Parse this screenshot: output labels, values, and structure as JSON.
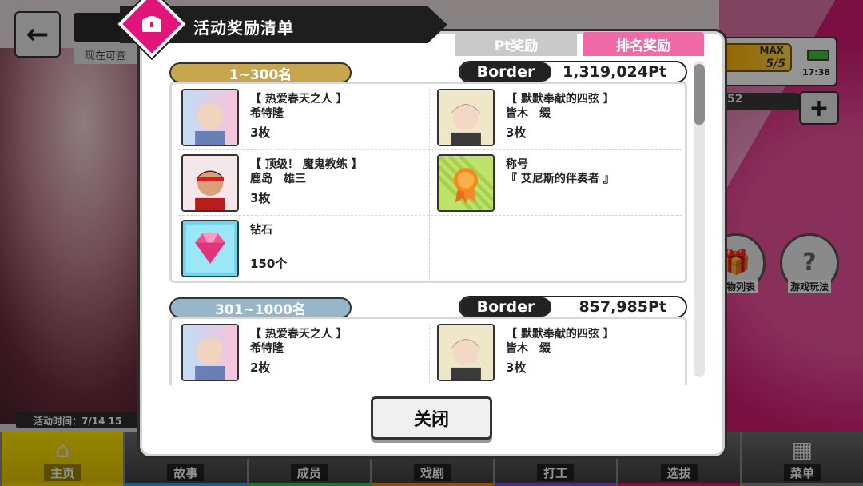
{
  "header": {
    "back_icon": "back-arrow-icon",
    "now_label": "现在可查"
  },
  "hud": {
    "energy_max": "MAX",
    "energy_count": "5/5",
    "clock": "17:38",
    "stat_value": "52",
    "plus_label": "+"
  },
  "side_buttons": [
    {
      "label": "礼物列表",
      "icon": "gift-icon"
    },
    {
      "label": "游戏玩法",
      "icon": "question-icon"
    }
  ],
  "event_time": "活动时间：7/14 15",
  "nav": [
    {
      "label": "主页",
      "icon": "home-icon",
      "color": "#f4d800"
    },
    {
      "label": "故事",
      "icon": "book-icon",
      "color": "#2ea3e6"
    },
    {
      "label": "成员",
      "icon": "people-icon",
      "color": "#2ec45d"
    },
    {
      "label": "戏剧",
      "icon": "drama-icon",
      "color": "#f08a1c"
    },
    {
      "label": "打工",
      "icon": "work-icon",
      "color": "#8a4bd6"
    },
    {
      "label": "选拔",
      "icon": "audition-icon",
      "color": "#e3137c"
    },
    {
      "label": "菜单",
      "icon": "grid-menu-icon",
      "color": "#888888"
    }
  ],
  "modal": {
    "title": "活动奖励清单",
    "icon": "treasure-chest-icon",
    "tabs": {
      "pt": "Pt奖励",
      "rank": "排名奖励"
    },
    "close_label": "关闭",
    "accent": "#e3137c"
  },
  "tiers": [
    {
      "range": "1~300名",
      "border_label": "Border",
      "border_value": "1,319,024Pt",
      "rewards": [
        {
          "name": "【 热爱春天之人 】",
          "sub": "希特隆",
          "qty": "3枚",
          "thumb": "card-blonde-hair"
        },
        {
          "name": "【 默默奉献的四弦 】",
          "sub": "皆木　缀",
          "qty": "3枚",
          "thumb": "card-brown-hair"
        },
        {
          "name": "【 顶级！ 魔鬼教练 】",
          "sub": "鹿岛　雄三",
          "qty": "3枚",
          "thumb": "card-headband"
        },
        {
          "name": "称号",
          "sub": "『 艾尼斯的伴奏者 』",
          "qty": "",
          "thumb": "title-badge"
        },
        {
          "name": "钻石",
          "sub": "",
          "qty": "150个",
          "thumb": "diamond"
        }
      ]
    },
    {
      "range": "301~1000名",
      "border_label": "Border",
      "border_value": "857,985Pt",
      "rewards": [
        {
          "name": "【 热爱春天之人 】",
          "sub": "希特隆",
          "qty": "2枚",
          "thumb": "card-blonde-hair"
        },
        {
          "name": "【 默默奉献的四弦 】",
          "sub": "皆木　缀",
          "qty": "3枚",
          "thumb": "card-brown-hair"
        }
      ]
    }
  ]
}
